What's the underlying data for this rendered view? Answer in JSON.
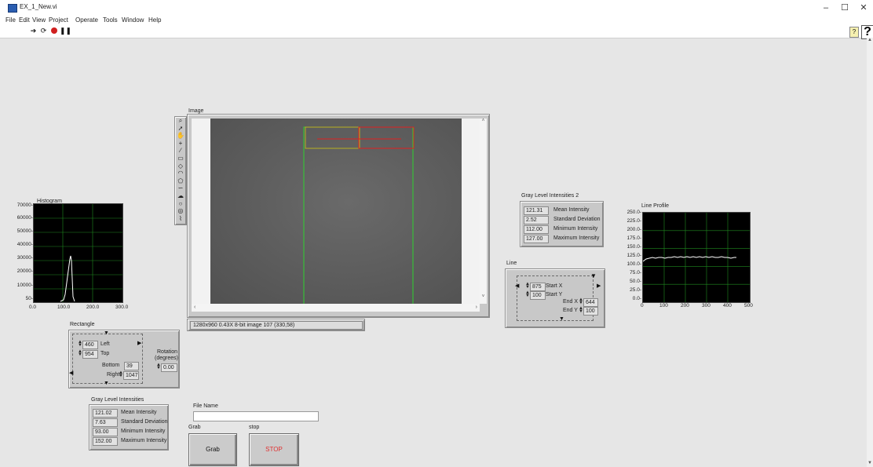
{
  "window": {
    "title": "EX_1_New.vi",
    "controls": {
      "minimize": "–",
      "maximize": "☐",
      "close": "✕"
    }
  },
  "menu": [
    "File",
    "Edit",
    "View",
    "Project",
    "Operate",
    "Tools",
    "Window",
    "Help"
  ],
  "toolbar": {
    "icons": [
      "run-arrow-icon",
      "run-continuous-icon",
      "abort-icon",
      "pause-icon"
    ],
    "help_label": "?"
  },
  "histogram": {
    "label": "Histogram",
    "y_ticks": [
      "70000-",
      "60000-",
      "50000-",
      "40000-",
      "30000-",
      "20000-",
      "10000-",
      "50-"
    ],
    "x_ticks": [
      "0.0",
      "100.0",
      "200.0",
      "300.0"
    ]
  },
  "image": {
    "label": "Image",
    "info": "1280x960 0.43X 8-bit image 107   (330,58)",
    "colors": {
      "roi_line": "#2fd12f",
      "roi_rect": "#e02020",
      "roi_rect_alt": "#b8b020"
    }
  },
  "rectangle": {
    "label": "Rectangle",
    "left_value": "460",
    "left_label": "Left",
    "top_value": "954",
    "top_label": "Top",
    "bottom_label": "Bottom",
    "bottom_value": "39",
    "right_label": "Right",
    "right_value": "1047",
    "rotation_label_1": "Rotation",
    "rotation_label_2": "(degrees)",
    "rotation_value": "0.00"
  },
  "gray_levels": {
    "label": "Gray Level Intensities",
    "rows": [
      {
        "value": "121.02",
        "name": "Mean Intensity"
      },
      {
        "value": "7.63",
        "name": "Standard Deviation"
      },
      {
        "value": "93.00",
        "name": "Minimum Intensity"
      },
      {
        "value": "152.00",
        "name": "Maximum Intensity"
      }
    ]
  },
  "gray_levels_2": {
    "label": "Gray Level Intensities 2",
    "rows": [
      {
        "value": "121.31",
        "name": "Mean Intensity"
      },
      {
        "value": "2.52",
        "name": "Standard Deviation"
      },
      {
        "value": "112.00",
        "name": "Minimum Intensity"
      },
      {
        "value": "127.00",
        "name": "Maximum Intensity"
      }
    ]
  },
  "line": {
    "label": "Line",
    "start_x_value": "875",
    "start_x_label": "Start X",
    "start_y_value": "100",
    "start_y_label": "Start Y",
    "end_x_label": "End X",
    "end_x_value": "644",
    "end_y_label": "End Y",
    "end_y_value": "100"
  },
  "line_profile": {
    "label": "Line Profile",
    "y_ticks": [
      "250.0-",
      "225.0-",
      "200.0-",
      "175.0-",
      "150.0-",
      "125.0-",
      "100.0-",
      "75.0-",
      "50.0-",
      "25.0-",
      "0.0-"
    ],
    "x_ticks": [
      "0",
      "100",
      "200",
      "300",
      "400",
      "500"
    ]
  },
  "file_name": {
    "label": "File Name",
    "value": ""
  },
  "grab": {
    "label": "Grab",
    "button": "Grab"
  },
  "stop": {
    "label": "stop",
    "button": "STOP",
    "button_color": "#e03030"
  }
}
